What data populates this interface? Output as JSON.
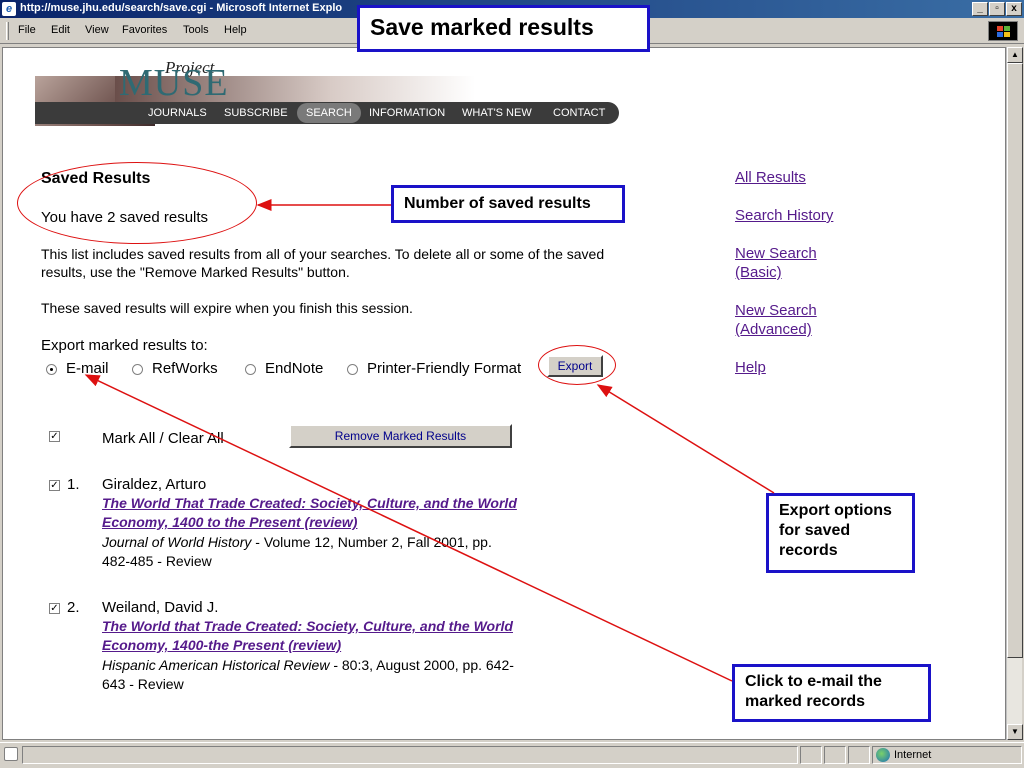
{
  "window": {
    "title": "http://muse.jhu.edu/search/save.cgi - Microsoft Internet Explo",
    "minimize": "_",
    "restore": "▫",
    "close": "x"
  },
  "menu": [
    "File",
    "Edit",
    "View",
    "Favorites",
    "Tools",
    "Help"
  ],
  "banner": {
    "project": "Project",
    "logo": "MUSE",
    "nav": [
      "JOURNALS",
      "SUBSCRIBE",
      "SEARCH",
      "INFORMATION",
      "WHAT'S NEW",
      "CONTACT"
    ],
    "active_nav": "SEARCH"
  },
  "page": {
    "heading": "Saved Results",
    "count_text": "You have 2 saved results",
    "desc_line1": "This list includes saved results from all of your searches. To delete all or some of the saved",
    "desc_line2": "results, use the \"Remove Marked Results\" button.",
    "expire": "These saved results will expire when you finish this session.",
    "export_label": "Export marked results to:",
    "export_options": [
      {
        "label": "E-mail",
        "selected": true
      },
      {
        "label": "RefWorks",
        "selected": false
      },
      {
        "label": "EndNote",
        "selected": false
      },
      {
        "label": "Printer-Friendly Format",
        "selected": false
      }
    ],
    "export_button": "Export",
    "mark_all": "Mark All / Clear All",
    "remove_button": "Remove Marked Results",
    "results": [
      {
        "num": "1.",
        "author": "Giraldez, Arturo",
        "title_line1": "The World That Trade Created: Society, Culture, and the World",
        "title_line2": "Economy, 1400 to the Present (review)",
        "journal": "Journal of World History",
        "cite_line1": " - Volume 12, Number 2, Fall 2001, pp.",
        "cite_line2": "482-485 - Review",
        "checked": true
      },
      {
        "num": "2.",
        "author": "Weiland, David J.",
        "title_line1": "The World that Trade Created: Society, Culture, and the World",
        "title_line2": "Economy, 1400-the Present (review)",
        "journal": "Hispanic American Historical Review",
        "cite_line1": " - 80:3, August 2000, pp. 642-",
        "cite_line2": "643 - Review",
        "checked": true
      }
    ]
  },
  "sidebar": {
    "all_results": "All Results",
    "search_history": "Search History",
    "new_basic_1": "New Search",
    "new_basic_2": "(Basic)",
    "new_adv_1": "New Search",
    "new_adv_2": "(Advanced)",
    "help": "Help"
  },
  "status": {
    "zone": "Internet"
  },
  "annotations": {
    "title": "Save marked results",
    "number": "Number of saved results",
    "export_1": "Export options",
    "export_2": "for saved",
    "export_3": "records",
    "email_1": "Click to e-mail the",
    "email_2": "marked records"
  },
  "colors": {
    "callout_border": "#1a12c8",
    "arrow": "#dd1111",
    "link": "#551a8b"
  }
}
